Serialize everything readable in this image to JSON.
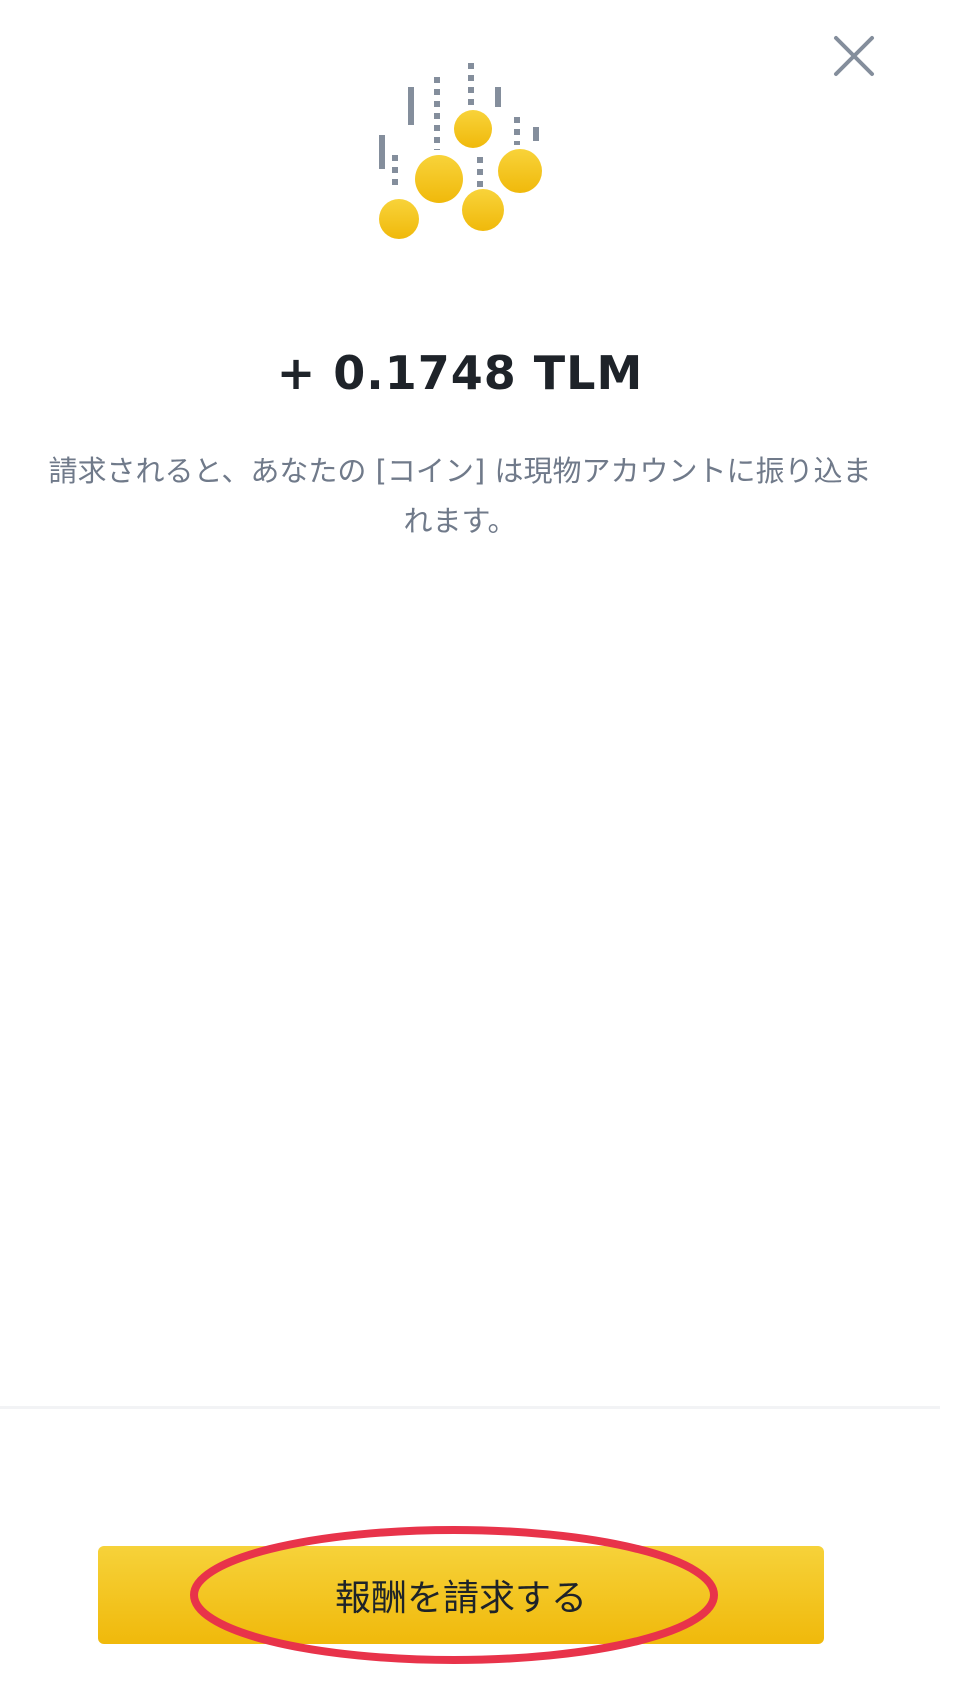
{
  "header": {
    "close_icon": "close-icon"
  },
  "hero": {
    "icon": "falling-coins-icon",
    "coin_color": "#f0b90b",
    "stroke_color": "#848e9c"
  },
  "reward": {
    "amount": "+ 0.1748 TLM",
    "description": "請求されると、あなたの [コイン] は現物アカウントに振り込まれます。"
  },
  "footer": {
    "claim_label": "報酬を請求する",
    "button_color": "#f0b90b",
    "annotation_color": "#e8334a"
  }
}
